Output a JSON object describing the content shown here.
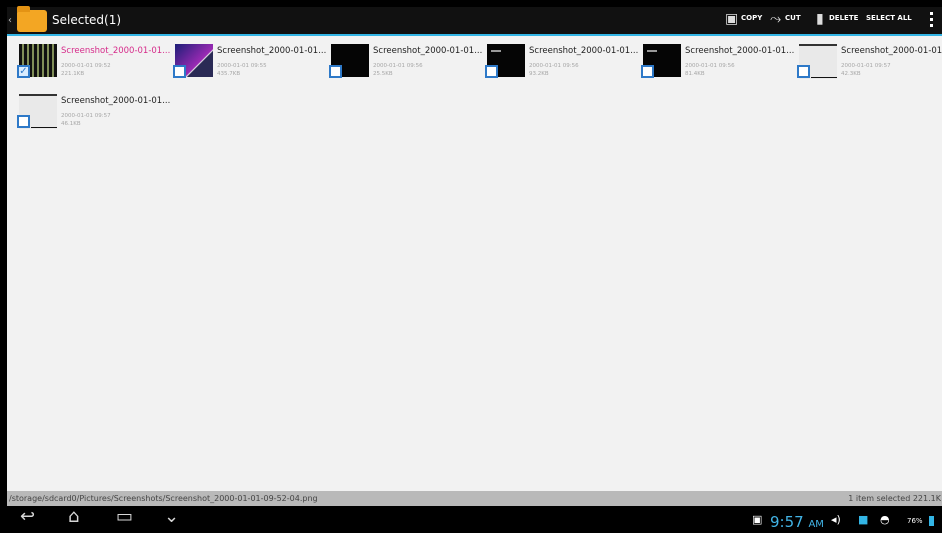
{
  "actionbar": {
    "title": "Selected(1)",
    "copy": "COPY",
    "cut": "CUT",
    "delete": "DELETE",
    "select_all": "SELECT ALL"
  },
  "files": [
    {
      "name": "Screenshot_2000-01-01...",
      "date": "2000-01-01 09:52",
      "size": "221.1KB",
      "checked": true
    },
    {
      "name": "Screenshot_2000-01-01...",
      "date": "2000-01-01 09:55",
      "size": "435.7KB",
      "checked": false
    },
    {
      "name": "Screenshot_2000-01-01...",
      "date": "2000-01-01 09:56",
      "size": "25.5KB",
      "checked": false
    },
    {
      "name": "Screenshot_2000-01-01...",
      "date": "2000-01-01 09:56",
      "size": "93.2KB",
      "checked": false
    },
    {
      "name": "Screenshot_2000-01-01...",
      "date": "2000-01-01 09:56",
      "size": "81.4KB",
      "checked": false
    },
    {
      "name": "Screenshot_2000-01-01",
      "date": "2000-01-01 09:57",
      "size": "42.3KB",
      "checked": false
    },
    {
      "name": "Screenshot_2000-01-01...",
      "date": "2000-01-01 09:57",
      "size": "46.1KB",
      "checked": false
    }
  ],
  "status": {
    "path": "/storage/sdcard0/Pictures/Screenshots/Screenshot_2000-01-01-09-52-04.png",
    "selection": "1 item selected   221.1K"
  },
  "system": {
    "time": "9:57",
    "ampm": "AM",
    "battery": "76%"
  }
}
